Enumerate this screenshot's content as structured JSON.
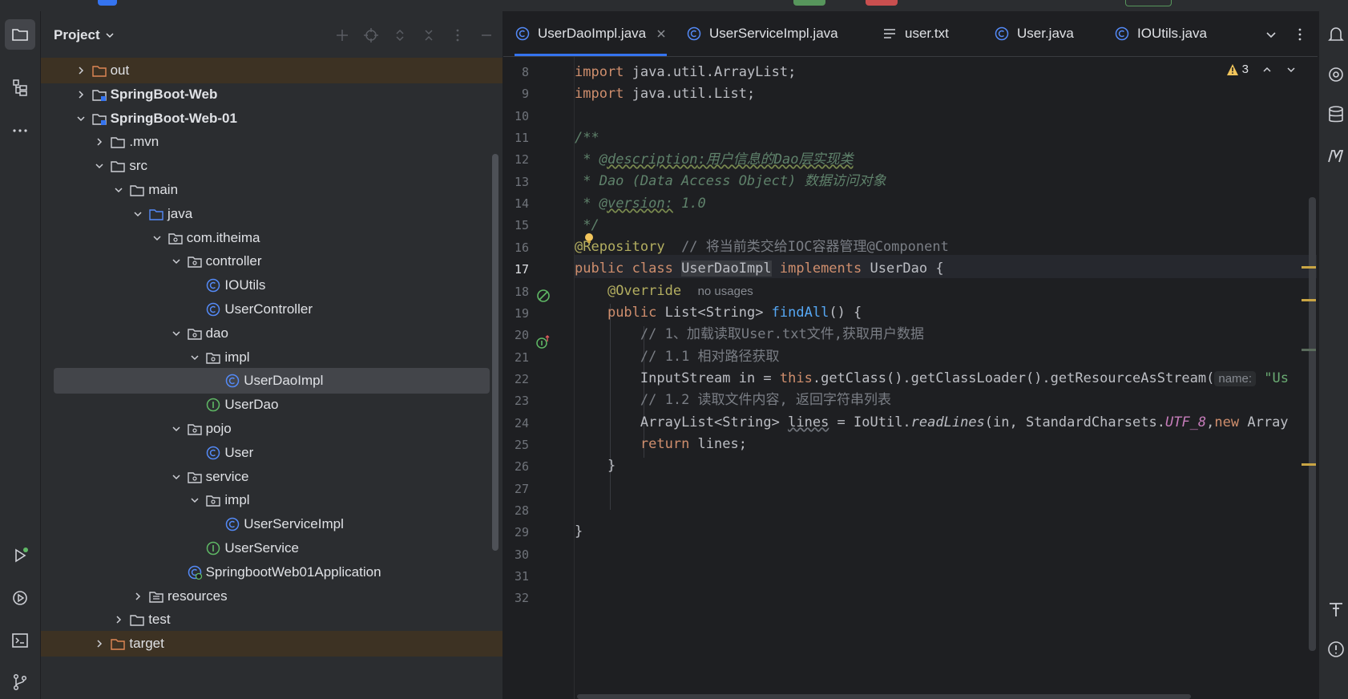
{
  "colors": {
    "accent": "#3574f0",
    "class_icon": "#548af7",
    "interface_icon": "#5fb865",
    "excluded_bg": "#3d3223",
    "warning": "#f2c55c"
  },
  "project_panel": {
    "title": "Project",
    "tree": [
      {
        "label": "out",
        "type": "folder-excluded",
        "depth": 2,
        "expanded": false
      },
      {
        "label": "SpringBoot-Web",
        "type": "module",
        "depth": 2,
        "expanded": false
      },
      {
        "label": "SpringBoot-Web-01",
        "type": "module",
        "depth": 2,
        "expanded": true
      },
      {
        "label": ".mvn",
        "type": "folder",
        "depth": 3,
        "expanded": false
      },
      {
        "label": "src",
        "type": "folder",
        "depth": 3,
        "expanded": true
      },
      {
        "label": "main",
        "type": "folder",
        "depth": 4,
        "expanded": true
      },
      {
        "label": "java",
        "type": "source-folder",
        "depth": 5,
        "expanded": true
      },
      {
        "label": "com.itheima",
        "type": "package",
        "depth": 6,
        "expanded": true
      },
      {
        "label": "controller",
        "type": "package",
        "depth": 7,
        "expanded": true
      },
      {
        "label": "IOUtils",
        "type": "class",
        "depth": 8
      },
      {
        "label": "UserController",
        "type": "class",
        "depth": 8
      },
      {
        "label": "dao",
        "type": "package",
        "depth": 7,
        "expanded": true
      },
      {
        "label": "impl",
        "type": "package",
        "depth": 8,
        "expanded": true
      },
      {
        "label": "UserDaoImpl",
        "type": "class",
        "depth": 9,
        "selected": true
      },
      {
        "label": "UserDao",
        "type": "interface",
        "depth": 8
      },
      {
        "label": "pojo",
        "type": "package",
        "depth": 7,
        "expanded": true
      },
      {
        "label": "User",
        "type": "class",
        "depth": 8
      },
      {
        "label": "service",
        "type": "package",
        "depth": 7,
        "expanded": true
      },
      {
        "label": "impl",
        "type": "package",
        "depth": 8,
        "expanded": true
      },
      {
        "label": "UserServiceImpl",
        "type": "class",
        "depth": 9
      },
      {
        "label": "UserService",
        "type": "interface",
        "depth": 8
      },
      {
        "label": "SpringbootWeb01Application",
        "type": "spring-class",
        "depth": 7
      },
      {
        "label": "resources",
        "type": "resources-folder",
        "depth": 5,
        "expanded": false
      },
      {
        "label": "test",
        "type": "folder",
        "depth": 4,
        "expanded": false
      },
      {
        "label": "target",
        "type": "folder-excluded",
        "depth": 3,
        "expanded": false
      }
    ]
  },
  "tabs": [
    {
      "label": "UserDaoImpl.java",
      "icon": "class-icon",
      "active": true
    },
    {
      "label": "UserServiceImpl.java",
      "icon": "class-icon"
    },
    {
      "label": "user.txt",
      "icon": "text-file-icon"
    },
    {
      "label": "User.java",
      "icon": "class-icon"
    },
    {
      "label": "IOUtils.java",
      "icon": "class-icon"
    }
  ],
  "editor": {
    "warning_count": "3",
    "current_line": 17,
    "line_numbers": [
      "8",
      "9",
      "10",
      "11",
      "12",
      "13",
      "14",
      "15",
      "16",
      "17",
      "18",
      "19",
      "20",
      "21",
      "22",
      "23",
      "24",
      "25",
      "26",
      "27",
      "28",
      "29",
      "30",
      "31",
      "32"
    ],
    "code": {
      "l8": {
        "kw": "import",
        "rest": " java.util.ArrayList;"
      },
      "l9": {
        "kw": "import",
        "rest": " java.util.List;"
      },
      "l11": "/**",
      "l12": {
        "prefix": " * ",
        "tag": "@description",
        "text": ":用户信息的Dao层实现类"
      },
      "l13": " * Dao (Data Access Object) 数据访问对象",
      "l14": {
        "prefix": " * ",
        "tag": "@version:",
        "text": " 1.0"
      },
      "l15": " */",
      "l16": {
        "ann": "@Repository",
        "comment": "  // 将当前类交给IOC容器管理@Component"
      },
      "l17": {
        "kw1": "public class ",
        "cls": "UserDaoImpl",
        "kw2": " implements ",
        "iface": "UserDao {"
      },
      "l18": {
        "ann": "@Override",
        "hint": "no usages"
      },
      "l19": {
        "kw": "public ",
        "type": "List<String> ",
        "fn": "findAll",
        "rest": "() {"
      },
      "l20": "// 1、加载读取User.txt文件,获取用户数据",
      "l21": "// 1.1 相对路径获取",
      "l22": {
        "a": "InputStream in = ",
        "kw": "this",
        "b": ".getClass().getClassLoader().getResourceAsStream(",
        "hint": "name:",
        "c": " \"Us"
      },
      "l23": "// 1.2 读取文件内容, 返回字符串列表",
      "l24": {
        "a": "ArrayList<String> ",
        "var": "lines",
        "b": " = IoUtil.",
        "fn": "readLines",
        "c": "(in, StandardCharsets.",
        "st": "UTF_8",
        "d": ",",
        "kw": "new",
        "e": " Array"
      },
      "l25": {
        "kw": "return",
        "rest": " lines;"
      },
      "l26": "}",
      "l29": "}"
    }
  }
}
